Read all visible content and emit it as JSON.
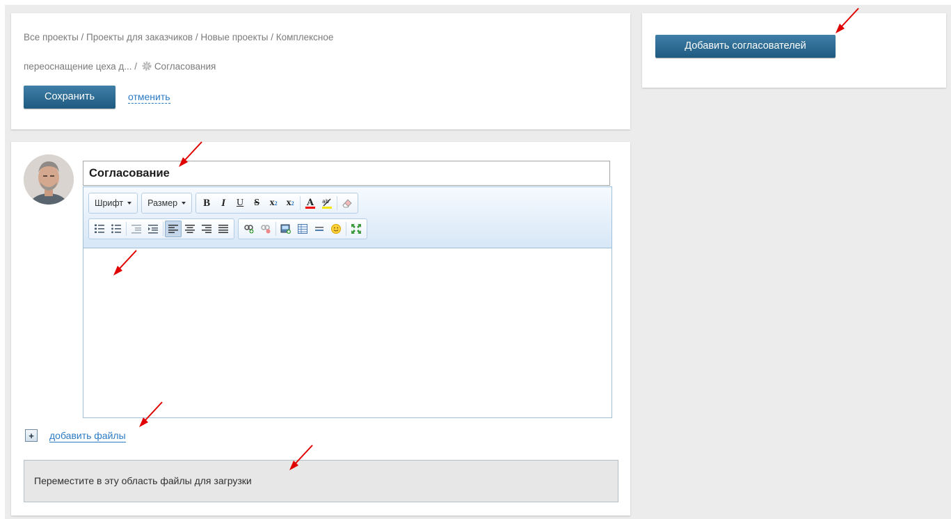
{
  "breadcrumb": {
    "line1": "Все проекты / Проекты для заказчиков / Новые проекты / Комплексное",
    "line2_text": "переоснащение цеха д... / ",
    "current": "Согласования"
  },
  "actions": {
    "save_label": "Сохранить",
    "cancel_label": "отменить",
    "add_approvers_label": "Добавить согласователей"
  },
  "document": {
    "title_value": "Согласование"
  },
  "toolbar": {
    "font_label": "Шрифт",
    "size_label": "Размер"
  },
  "files": {
    "add_label": "добавить файлы",
    "dropzone_text": "Переместите в эту область файлы для загрузки"
  },
  "colors": {
    "accent": "#2b6a93",
    "link": "#2b7ac4",
    "annotation_arrow": "#e00000"
  }
}
